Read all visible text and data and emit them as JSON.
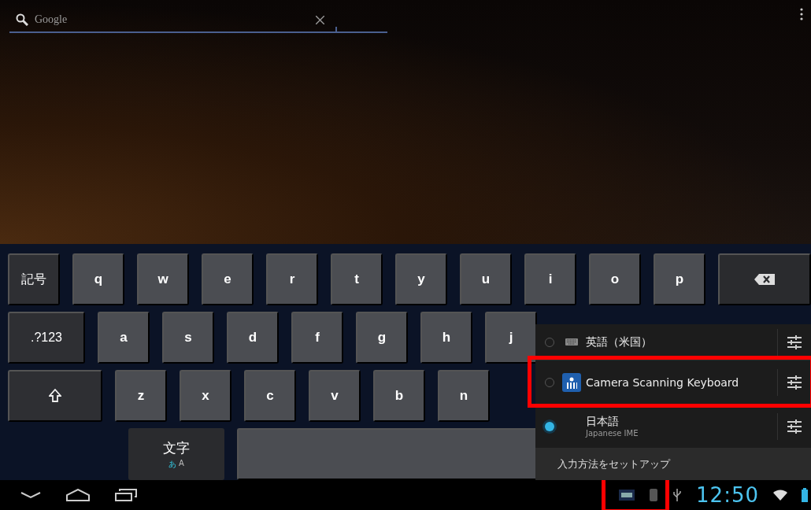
{
  "search": {
    "placeholder": "Google"
  },
  "keyboard": {
    "rows": [
      {
        "keys": [
          {
            "kind": "function",
            "label": "記号"
          },
          {
            "kind": "letter",
            "label": "q"
          },
          {
            "kind": "letter",
            "label": "w"
          },
          {
            "kind": "letter",
            "label": "e"
          },
          {
            "kind": "letter",
            "label": "r"
          },
          {
            "kind": "letter",
            "label": "t"
          },
          {
            "kind": "letter",
            "label": "y"
          },
          {
            "kind": "letter",
            "label": "u"
          },
          {
            "kind": "letter",
            "label": "i"
          },
          {
            "kind": "letter",
            "label": "o"
          },
          {
            "kind": "letter",
            "label": "p"
          },
          {
            "kind": "backspace"
          }
        ]
      },
      {
        "keys": [
          {
            "kind": "wide",
            "label": ".?123"
          },
          {
            "kind": "letter",
            "label": "a"
          },
          {
            "kind": "letter",
            "label": "s"
          },
          {
            "kind": "letter",
            "label": "d"
          },
          {
            "kind": "letter",
            "label": "f"
          },
          {
            "kind": "letter",
            "label": "g"
          },
          {
            "kind": "letter",
            "label": "h"
          },
          {
            "kind": "letter",
            "label": "j"
          }
        ]
      },
      {
        "keys": [
          {
            "kind": "shift"
          },
          {
            "kind": "letter",
            "label": "z"
          },
          {
            "kind": "letter",
            "label": "x"
          },
          {
            "kind": "letter",
            "label": "c"
          },
          {
            "kind": "letter",
            "label": "v"
          },
          {
            "kind": "letter",
            "label": "b"
          },
          {
            "kind": "letter",
            "label": "n"
          }
        ]
      },
      {
        "keys": [
          {
            "kind": "mode",
            "label": "文字",
            "options": [
              {
                "label": "あ",
                "selected": true
              },
              {
                "label": "A",
                "selected": false
              }
            ]
          },
          {
            "kind": "space"
          }
        ]
      }
    ]
  },
  "input_methods": [
    {
      "kind": "keyboard",
      "title": "英語（米国）",
      "selected": false,
      "highlighted": false
    },
    {
      "kind": "app",
      "title": "Camera Scanning Keyboard",
      "selected": false,
      "highlighted": true
    },
    {
      "kind": "plain",
      "title": "日本語",
      "subtitle": "Japanese IME",
      "selected": true,
      "highlighted": false
    }
  ],
  "setup_label": "入力方法をセットアップ",
  "status_bar": {
    "time": "12:50",
    "icons_highlighted": true
  }
}
